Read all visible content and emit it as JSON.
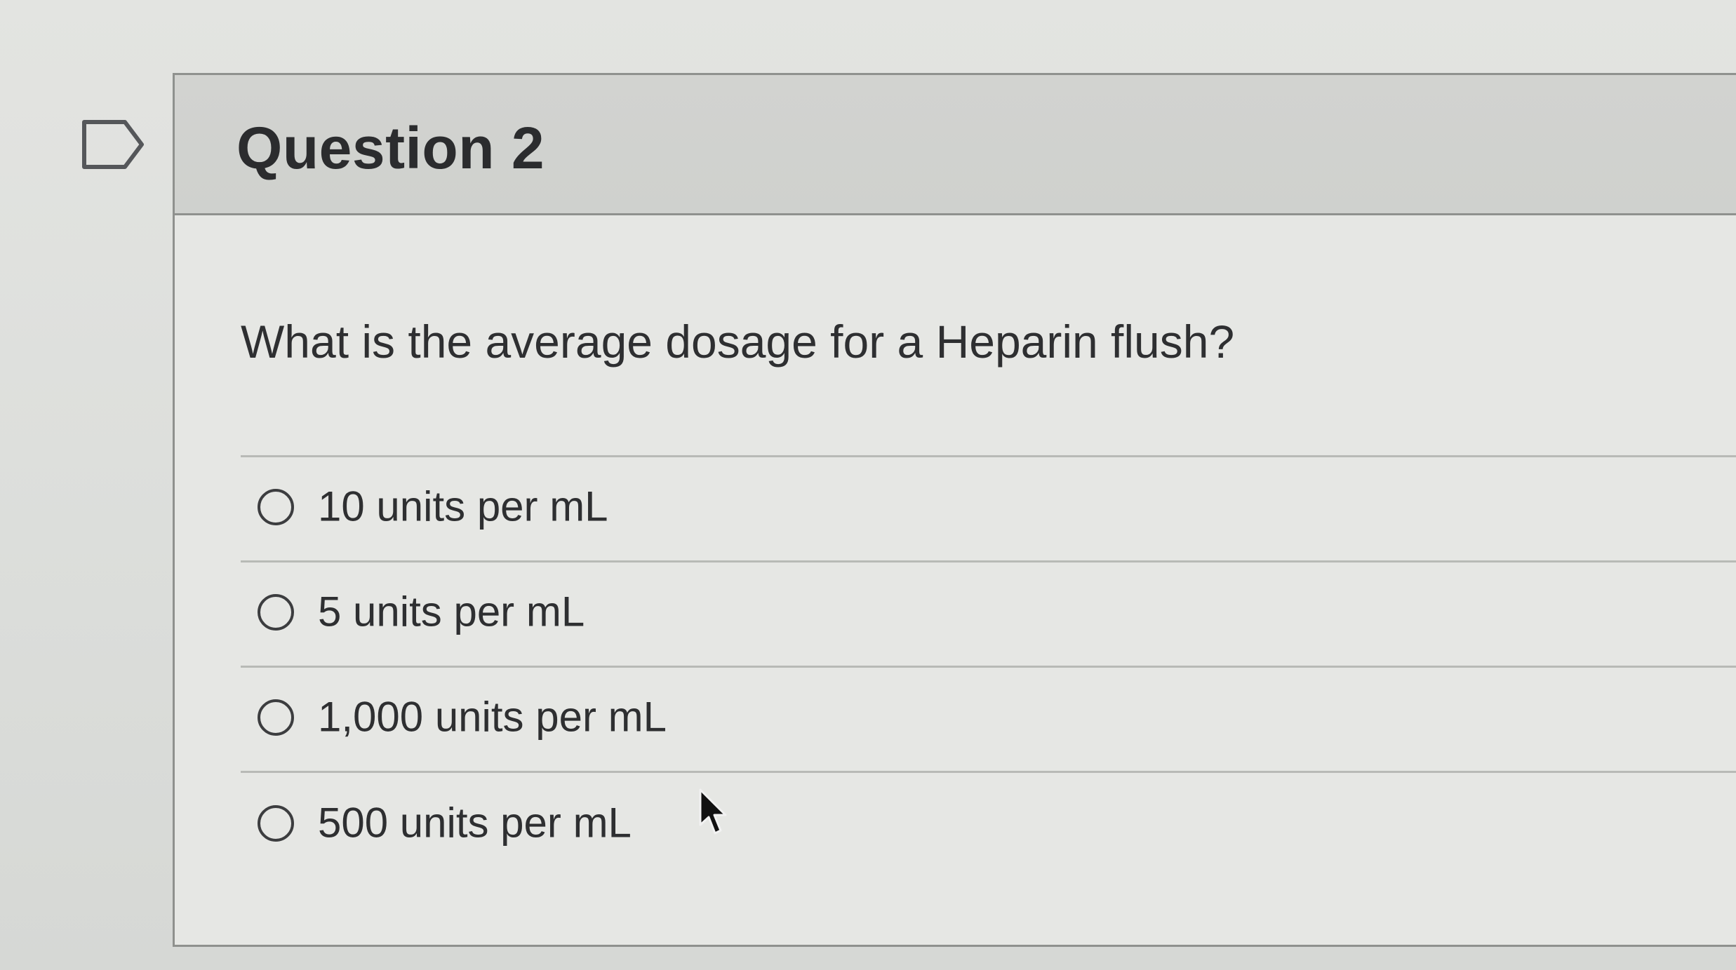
{
  "question": {
    "title": "Question 2",
    "text": "What is the average dosage for a Heparin flush?",
    "options": [
      {
        "label": "10 units per mL"
      },
      {
        "label": "5 units per mL"
      },
      {
        "label": "1,000 units per mL"
      },
      {
        "label": "500 units per mL"
      }
    ]
  },
  "icons": {
    "flag": "flag-icon",
    "radio": "radio-unchecked-icon",
    "cursor": "mouse-pointer-icon"
  },
  "colors": {
    "text": "#2e2f31",
    "border": "#8f918e",
    "header_bg": "#d2d3d0"
  }
}
